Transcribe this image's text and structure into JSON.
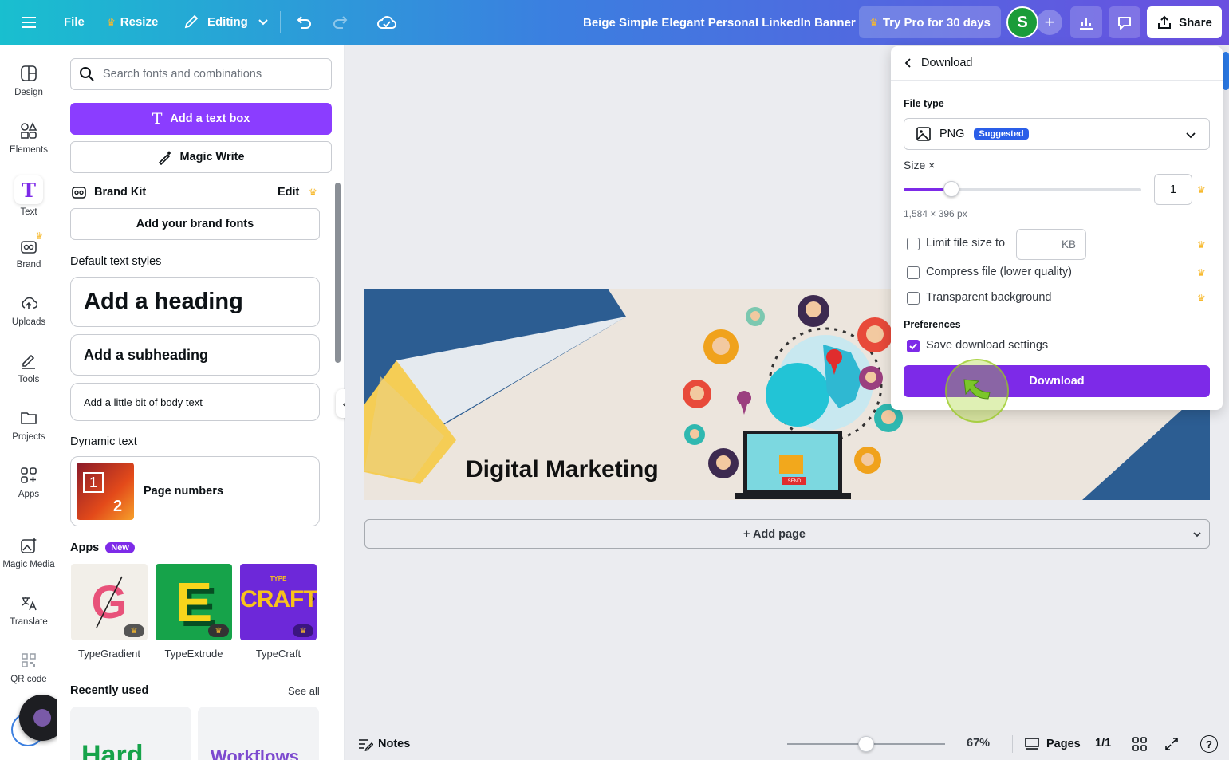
{
  "topbar": {
    "file": "File",
    "resize": "Resize",
    "editing": "Editing",
    "doc_title": "Beige Simple Elegant Personal LinkedIn Banner",
    "try_pro": "Try Pro for 30 days",
    "avatar_letter": "S",
    "share": "Share"
  },
  "sidebar": {
    "items": [
      {
        "label": "Design",
        "icon": "design-icon"
      },
      {
        "label": "Elements",
        "icon": "elements-icon"
      },
      {
        "label": "Text",
        "icon": "text-icon"
      },
      {
        "label": "Brand",
        "icon": "brand-icon"
      },
      {
        "label": "Uploads",
        "icon": "uploads-icon"
      },
      {
        "label": "Tools",
        "icon": "tools-icon"
      },
      {
        "label": "Projects",
        "icon": "projects-icon"
      },
      {
        "label": "Apps",
        "icon": "apps-icon"
      },
      {
        "label": "Magic Media",
        "icon": "magic-media-icon"
      },
      {
        "label": "Translate",
        "icon": "translate-icon"
      },
      {
        "label": "QR code",
        "icon": "qr-code-icon"
      }
    ]
  },
  "panel": {
    "search_placeholder": "Search fonts and combinations",
    "add_text_box": "Add a text box",
    "magic_write": "Magic Write",
    "brand_kit": "Brand Kit",
    "brand_edit": "Edit",
    "add_brand_fonts": "Add your brand fonts",
    "default_styles": "Default text styles",
    "heading": "Add a heading",
    "subheading": "Add a subheading",
    "body": "Add a little bit of body text",
    "dynamic_text": "Dynamic text",
    "page_numbers": "Page numbers",
    "pn_digit1": "1",
    "pn_digit2": "2",
    "apps": "Apps",
    "apps_badge": "New",
    "app_tiles": [
      {
        "name": "TypeGradient",
        "glyph": "G"
      },
      {
        "name": "TypeExtrude",
        "glyph": "E"
      },
      {
        "name": "TypeCraft",
        "glyph": "CRAFT",
        "small": "TYPE"
      }
    ],
    "recently_used": "Recently used",
    "see_all": "See all",
    "recent": [
      "Hard",
      "Workflows"
    ]
  },
  "canvas": {
    "banner_text": "Digital Marketing",
    "send_label": "SEND",
    "add_page": "+ Add page"
  },
  "download": {
    "back_title": "Download",
    "file_type_label": "File type",
    "file_type": "PNG",
    "suggested": "Suggested",
    "size_label": "Size ×",
    "size_value": "1",
    "size_fraction": 0.2,
    "dimensions": "1,584 × 396 px",
    "limit_file_size": "Limit file size to",
    "kb": "KB",
    "compress": "Compress file (lower quality)",
    "transparent": "Transparent background",
    "preferences": "Preferences",
    "save_settings": "Save download settings",
    "download_btn": "Download"
  },
  "bottombar": {
    "notes": "Notes",
    "zoom": "67%",
    "zoom_fraction": 0.5,
    "pages": "Pages",
    "page_count": "1/1"
  },
  "colors": {
    "accent": "#7d2ae8",
    "crown": "#f7b92d",
    "green_avatar": "#1a9c39",
    "suggested_badge": "#2a5ee8"
  }
}
